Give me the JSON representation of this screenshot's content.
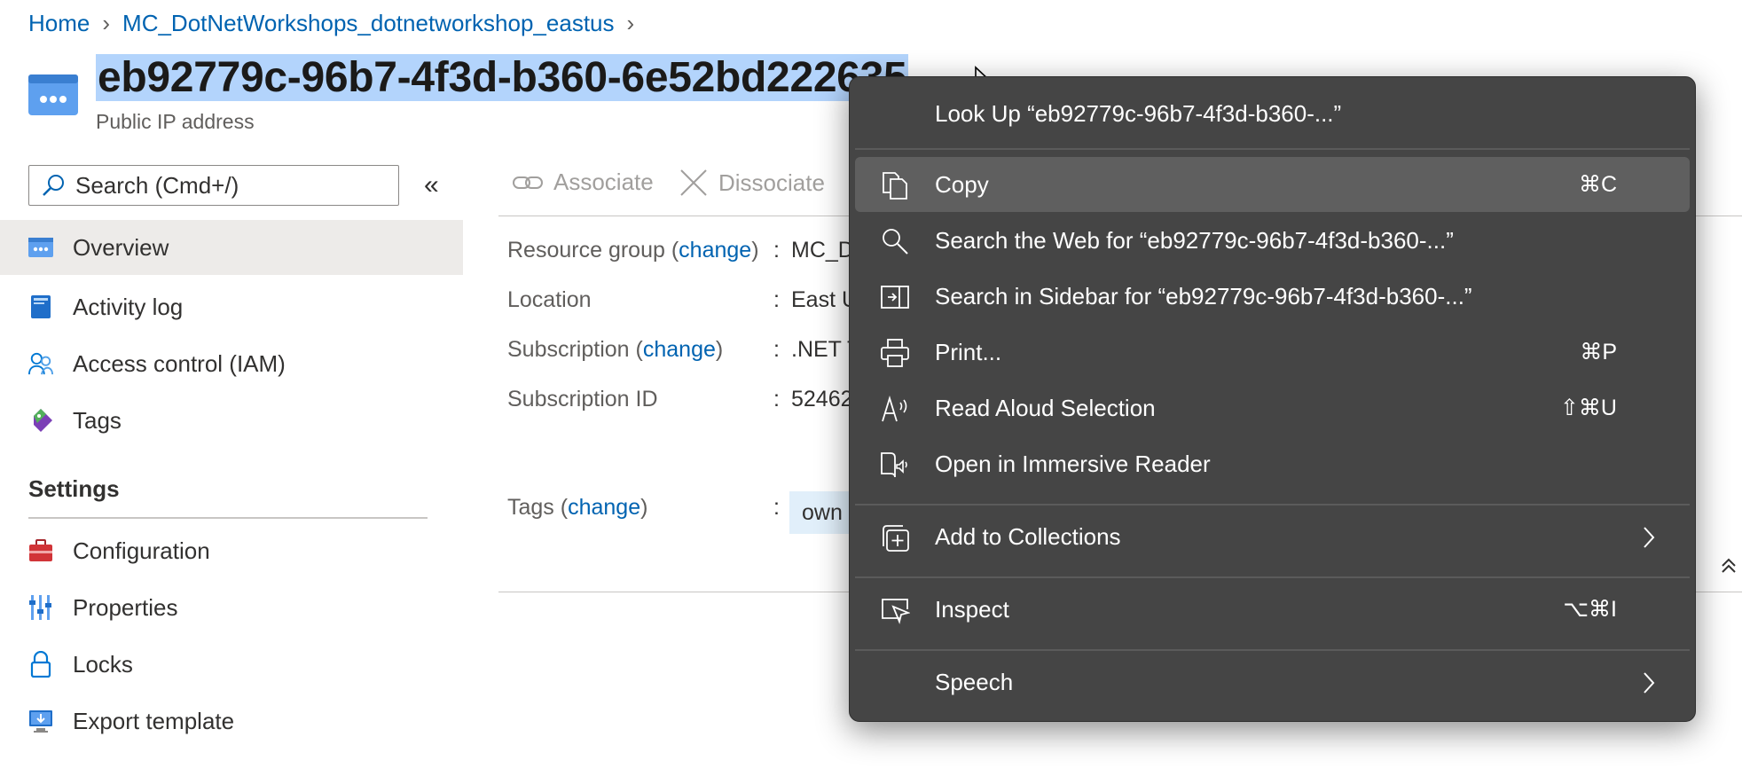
{
  "breadcrumb": {
    "items": [
      "Home",
      "MC_DotNetWorkshops_dotnetworkshop_eastus"
    ]
  },
  "resource": {
    "title": "eb92779c-96b7-4f3d-b360-6e52bd222635",
    "subtitle": "Public IP address",
    "icon": "public-ip-icon"
  },
  "sidebar": {
    "search_placeholder": "Search (Cmd+/)",
    "collapse_glyph": "«",
    "items": [
      {
        "label": "Overview",
        "icon": "overview-icon",
        "active": true
      },
      {
        "label": "Activity log",
        "icon": "activity-log-icon"
      },
      {
        "label": "Access control (IAM)",
        "icon": "iam-icon"
      },
      {
        "label": "Tags",
        "icon": "tag-icon"
      }
    ],
    "settings_heading": "Settings",
    "settings_items": [
      {
        "label": "Configuration",
        "icon": "toolbox-icon"
      },
      {
        "label": "Properties",
        "icon": "properties-icon"
      },
      {
        "label": "Locks",
        "icon": "lock-icon"
      },
      {
        "label": "Export template",
        "icon": "export-template-icon"
      }
    ]
  },
  "toolbar": {
    "associate": "Associate",
    "dissociate": "Dissociate"
  },
  "essentials": {
    "resource_group": {
      "label": "Resource group",
      "change": "change",
      "value": "MC_D"
    },
    "location": {
      "label": "Location",
      "value": "East U"
    },
    "subscription": {
      "label": "Subscription",
      "change": "change",
      "value": ".NET T"
    },
    "subscription_id": {
      "label": "Subscription ID",
      "value": "52462"
    },
    "tags": {
      "label": "Tags",
      "change": "change",
      "value": "own"
    },
    "colon": ":"
  },
  "context_menu": {
    "look_up": "Look Up “eb92779c-96b7-4f3d-b360-...”",
    "copy": {
      "label": "Copy",
      "shortcut": "⌘C",
      "icon": "copy-icon"
    },
    "search_web": {
      "label": "Search the Web for “eb92779c-96b7-4f3d-b360-...”",
      "icon": "search-icon"
    },
    "search_sidebar": {
      "label": "Search in Sidebar for “eb92779c-96b7-4f3d-b360-...”",
      "icon": "sidebar-search-icon"
    },
    "print": {
      "label": "Print...",
      "shortcut": "⌘P",
      "icon": "printer-icon"
    },
    "read_aloud": {
      "label": "Read Aloud Selection",
      "shortcut": "⇧⌘U",
      "icon": "read-aloud-icon"
    },
    "immersive": {
      "label": "Open in Immersive Reader",
      "icon": "immersive-reader-icon"
    },
    "collections": {
      "label": "Add to Collections",
      "icon": "collections-icon"
    },
    "inspect": {
      "label": "Inspect",
      "shortcut": "⌥⌘I",
      "icon": "inspect-icon"
    },
    "speech": {
      "label": "Speech"
    }
  },
  "colors": {
    "link": "#0063b1",
    "selection": "#b3d4fc",
    "menu_bg": "#454545",
    "menu_highlight": "#5f5f5f"
  }
}
